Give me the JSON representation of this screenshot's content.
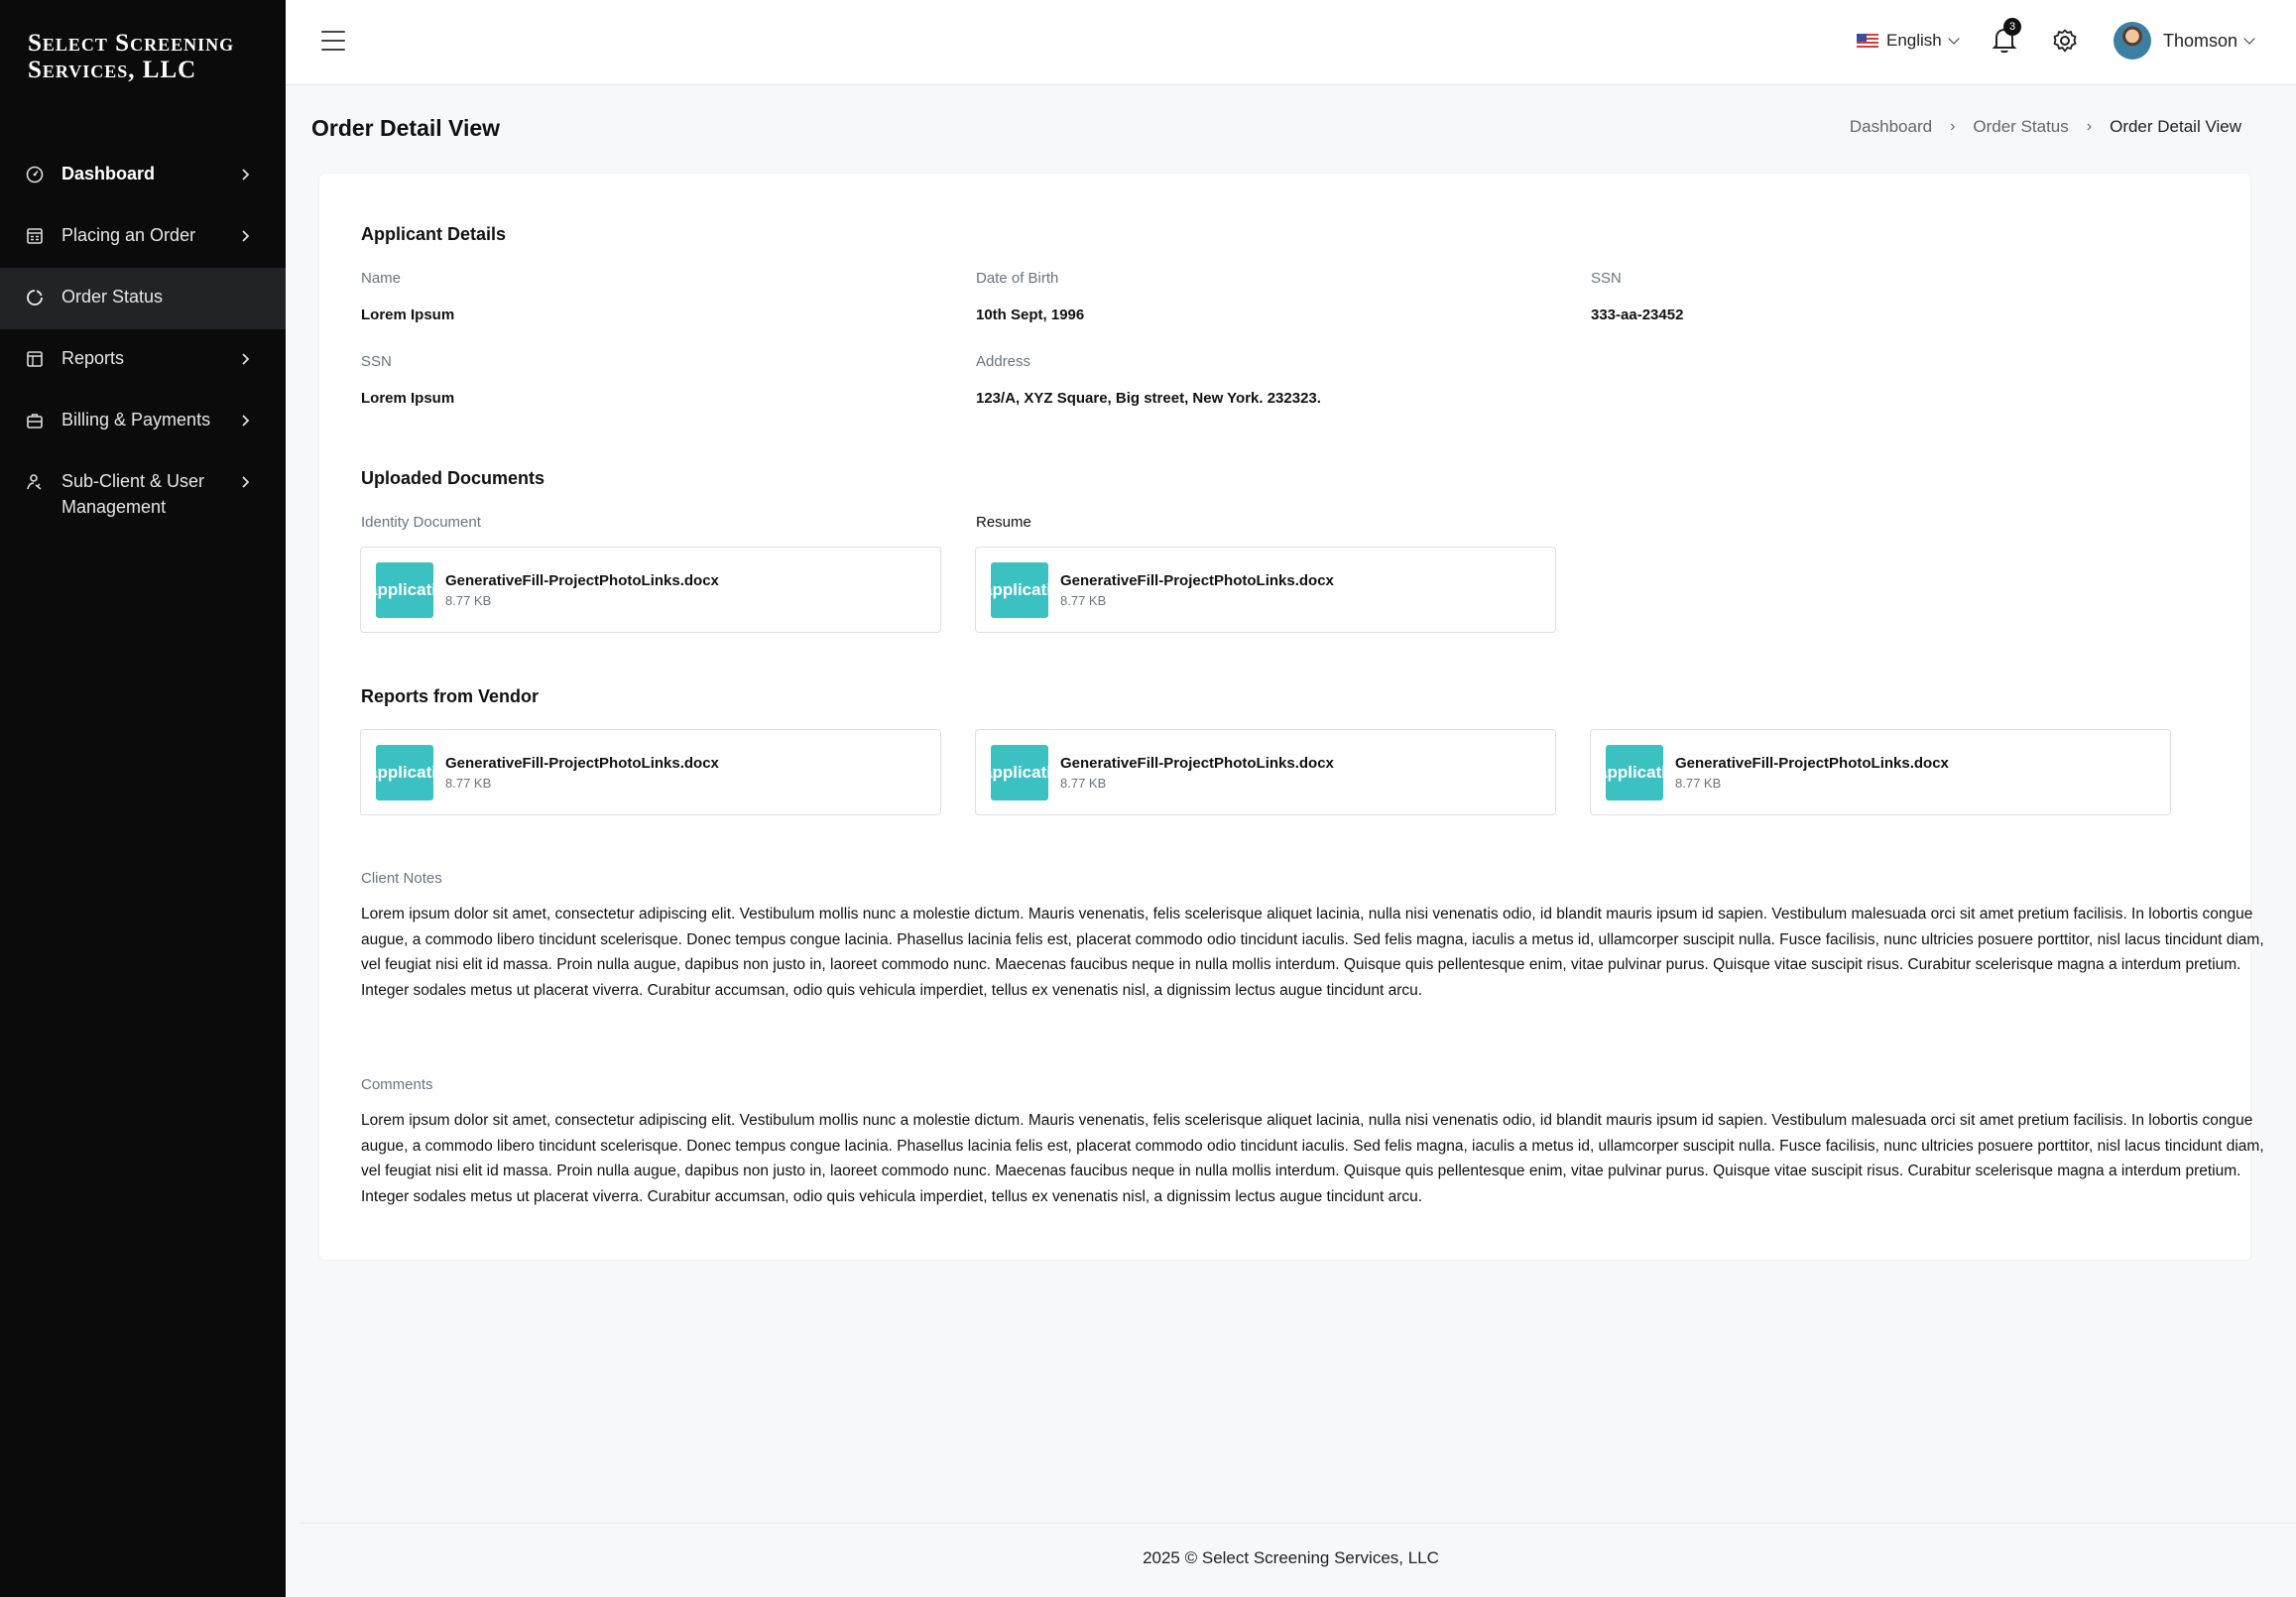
{
  "brand": {
    "line1": "Select Screening",
    "line2": "Services, LLC"
  },
  "sidebar": {
    "items": [
      {
        "label": "Dashboard",
        "icon": "gauge-icon"
      },
      {
        "label": "Placing an Order",
        "icon": "order-form-icon"
      },
      {
        "label": "Order Status",
        "icon": "status-circle-icon"
      },
      {
        "label": "Reports",
        "icon": "report-icon"
      },
      {
        "label": "Billing & Payments",
        "icon": "briefcase-icon"
      },
      {
        "label": "Sub-Client & User Management",
        "icon": "user-manage-icon"
      }
    ]
  },
  "topbar": {
    "language": "English",
    "notification_count": "3",
    "user_name": "Thomson"
  },
  "page": {
    "title": "Order Detail View",
    "breadcrumb": [
      "Dashboard",
      "Order Status",
      "Order Detail View"
    ]
  },
  "applicant": {
    "title": "Applicant Details",
    "fields": [
      {
        "label": "Name",
        "value": "Lorem Ipsum"
      },
      {
        "label": "Date of Birth",
        "value": "10th Sept, 1996"
      },
      {
        "label": "SSN",
        "value": "333-aa-23452"
      },
      {
        "label": "SSN",
        "value": "Lorem Ipsum"
      },
      {
        "label": "Address",
        "value": "123/A, XYZ Square, Big street, New York. 232323."
      }
    ]
  },
  "uploaded": {
    "title": "Uploaded Documents",
    "identity_label": "Identity Document",
    "resume_label": "Resume",
    "files": [
      {
        "icon_text": "application",
        "name": "GenerativeFill-ProjectPhotoLinks.docx",
        "size": "8.77 KB"
      },
      {
        "icon_text": "application",
        "name": "GenerativeFill-ProjectPhotoLinks.docx",
        "size": "8.77 KB"
      }
    ]
  },
  "vendor": {
    "title": "Reports from Vendor",
    "files": [
      {
        "icon_text": "application",
        "name": "GenerativeFill-ProjectPhotoLinks.docx",
        "size": "8.77 KB"
      },
      {
        "icon_text": "application",
        "name": "GenerativeFill-ProjectPhotoLinks.docx",
        "size": "8.77 KB"
      },
      {
        "icon_text": "application",
        "name": "GenerativeFill-ProjectPhotoLinks.docx",
        "size": "8.77 KB"
      }
    ]
  },
  "notes": {
    "client_label": "Client Notes",
    "client_text": "Lorem ipsum dolor sit amet, consectetur adipiscing elit. Vestibulum mollis nunc a molestie dictum. Mauris venenatis, felis scelerisque aliquet lacinia, nulla nisi venenatis odio, id blandit mauris ipsum id sapien. Vestibulum malesuada orci sit amet pretium facilisis. In lobortis congue augue, a commodo libero tincidunt scelerisque. Donec tempus congue lacinia. Phasellus lacinia felis est, placerat commodo odio tincidunt iaculis. Sed felis magna, iaculis a metus id, ullamcorper suscipit nulla. Fusce facilisis, nunc ultricies posuere porttitor, nisl lacus tincidunt diam, vel feugiat nisi elit id massa. Proin nulla augue, dapibus non justo in, laoreet commodo nunc. Maecenas faucibus neque in nulla mollis interdum. Quisque quis pellentesque enim, vitae pulvinar purus. Quisque vitae suscipit risus. Curabitur scelerisque magna a interdum pretium. Integer sodales metus ut placerat viverra. Curabitur accumsan, odio quis vehicula imperdiet, tellus ex venenatis nisl, a dignissim lectus augue tincidunt arcu.",
    "comments_label": "Comments",
    "comments_text": "Lorem ipsum dolor sit amet, consectetur adipiscing elit. Vestibulum mollis nunc a molestie dictum. Mauris venenatis, felis scelerisque aliquet lacinia, nulla nisi venenatis odio, id blandit mauris ipsum id sapien. Vestibulum malesuada orci sit amet pretium facilisis. In lobortis congue augue, a commodo libero tincidunt scelerisque. Donec tempus congue lacinia. Phasellus lacinia felis est, placerat commodo odio tincidunt iaculis. Sed felis magna, iaculis a metus id, ullamcorper suscipit nulla. Fusce facilisis, nunc ultricies posuere porttitor, nisl lacus tincidunt diam, vel feugiat nisi elit id massa. Proin nulla augue, dapibus non justo in, laoreet commodo nunc. Maecenas faucibus neque in nulla mollis interdum. Quisque quis pellentesque enim, vitae pulvinar purus. Quisque vitae suscipit risus. Curabitur scelerisque magna a interdum pretium. Integer sodales metus ut placerat viverra. Curabitur accumsan, odio quis vehicula imperdiet, tellus ex venenatis nisl, a dignissim lectus augue tincidunt arcu."
  },
  "footer": {
    "text": "2025 © Select Screening Services, LLC"
  },
  "colors": {
    "sidebar_bg": "#0b0b0c",
    "file_icon": "#3cc1c3",
    "page_bg": "#f7f8fa"
  }
}
